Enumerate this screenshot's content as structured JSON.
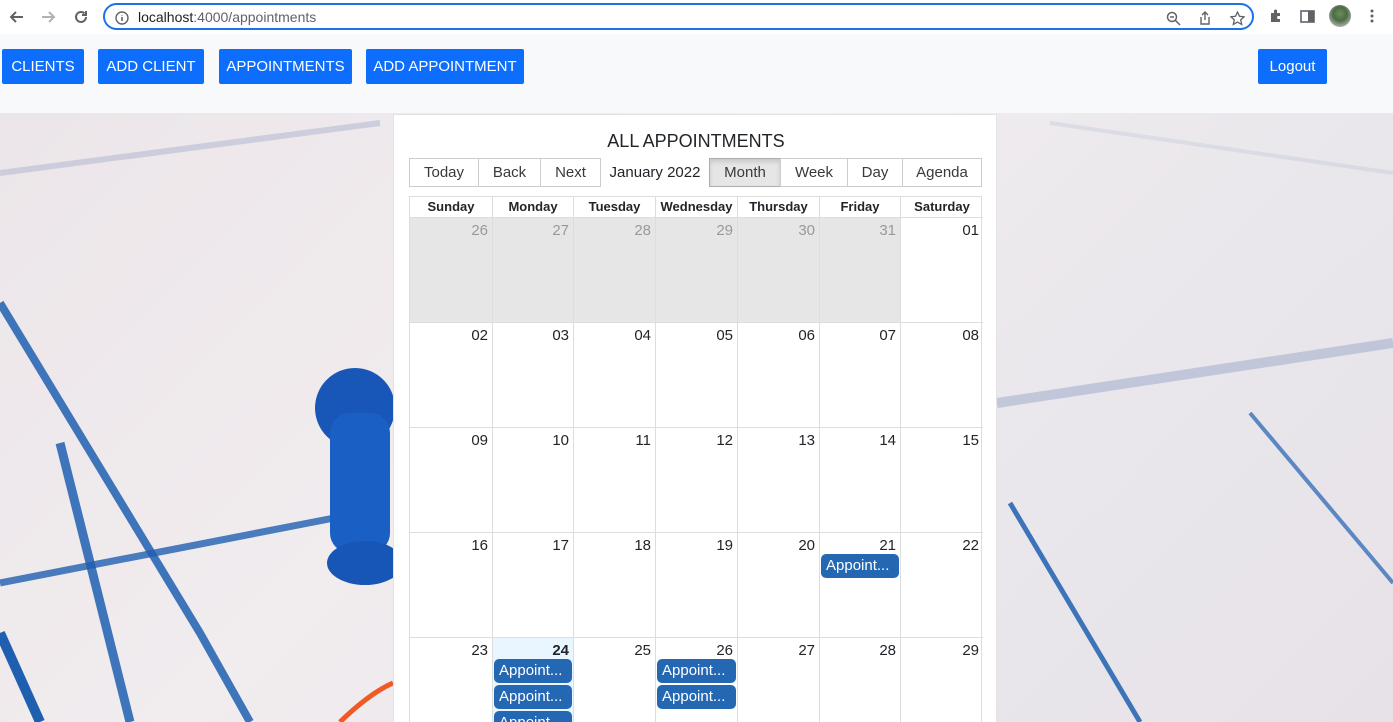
{
  "browser": {
    "url_host": "localhost",
    "url_path": ":4000/appointments"
  },
  "nav": {
    "clients": "CLIENTS",
    "add_client": "ADD CLIENT",
    "appointments": "APPOINTMENTS",
    "add_appointment": "ADD APPOINTMENT",
    "logout": "Logout"
  },
  "calendar": {
    "title": "ALL APPOINTMENTS",
    "toolbar": {
      "today": "Today",
      "back": "Back",
      "next": "Next",
      "label": "January 2022",
      "month": "Month",
      "week": "Week",
      "day": "Day",
      "agenda": "Agenda",
      "active_view": "Month"
    },
    "weekdays": [
      "Sunday",
      "Monday",
      "Tuesday",
      "Wednesday",
      "Thursday",
      "Friday",
      "Saturday"
    ],
    "weeks": [
      [
        "26",
        "27",
        "28",
        "29",
        "30",
        "31",
        "01"
      ],
      [
        "02",
        "03",
        "04",
        "05",
        "06",
        "07",
        "08"
      ],
      [
        "09",
        "10",
        "11",
        "12",
        "13",
        "14",
        "15"
      ],
      [
        "16",
        "17",
        "18",
        "19",
        "20",
        "21",
        "22"
      ],
      [
        "23",
        "24",
        "25",
        "26",
        "27",
        "28",
        "29"
      ]
    ],
    "event_label": "Appoint...",
    "event_label_cut": "Appoint...",
    "event_color": "#2468b4",
    "today_date": "24"
  }
}
